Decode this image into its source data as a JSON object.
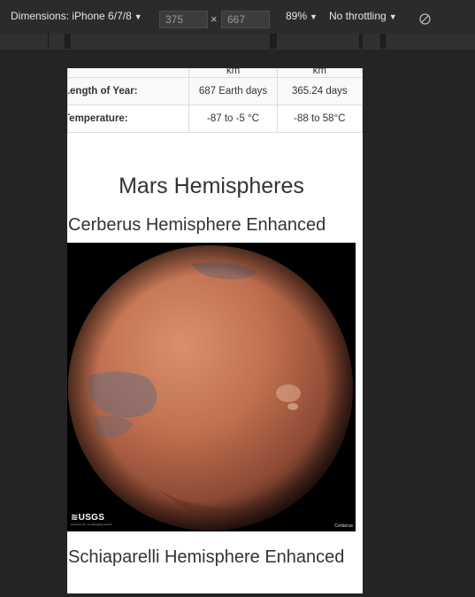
{
  "toolbar": {
    "dimensions_label": "Dimensions: iPhone 6/7/8",
    "width_value": "375",
    "height_value": "667",
    "times": "×",
    "zoom": "89%",
    "throttling": "No throttling",
    "icons": {
      "dropdown": "caret-down-icon",
      "rotate": "rotate-icon"
    }
  },
  "page": {
    "facts_table": {
      "rows": [
        {
          "label": "",
          "mars": "km",
          "earth": "km"
        },
        {
          "label": "Length of Year:",
          "mars": "687 Earth days",
          "earth": "365.24 days"
        },
        {
          "label": "Temperature:",
          "mars": "-87 to -5 °C",
          "earth": "-88 to 58°C"
        }
      ]
    },
    "section_title": "Mars Hemispheres",
    "hemispheres": [
      {
        "title": "Cerberus Hemisphere Enhanced",
        "logo": "≋USGS",
        "logo_sub": "science for a changing world",
        "caption": "Cerberus"
      },
      {
        "title": "Schiaparelli Hemisphere Enhanced"
      }
    ]
  }
}
